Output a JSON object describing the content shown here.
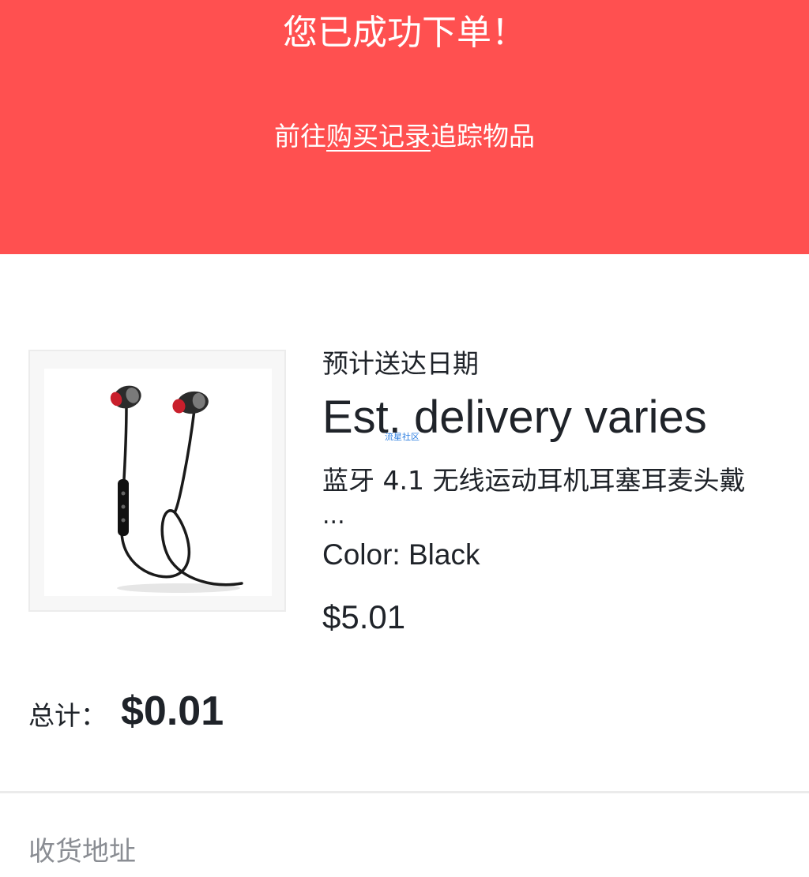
{
  "banner": {
    "title": "您已成功下单！",
    "sub_prefix": "前往",
    "sub_link": "购买记录",
    "sub_suffix": "追踪物品",
    "background": "#ff5050"
  },
  "delivery": {
    "label": "预计送达日期",
    "value": "Est. delivery varies"
  },
  "watermark": "流星社区",
  "product": {
    "image_icon": "earphones-image",
    "title": "蓝牙 4.1 无线运动耳机耳塞耳麦头戴",
    "ellipsis": "...",
    "variant": "Color: Black",
    "price": "$5.01"
  },
  "total": {
    "label": "总计：",
    "value": "$0.01"
  },
  "shipping": {
    "label": "收货地址"
  }
}
